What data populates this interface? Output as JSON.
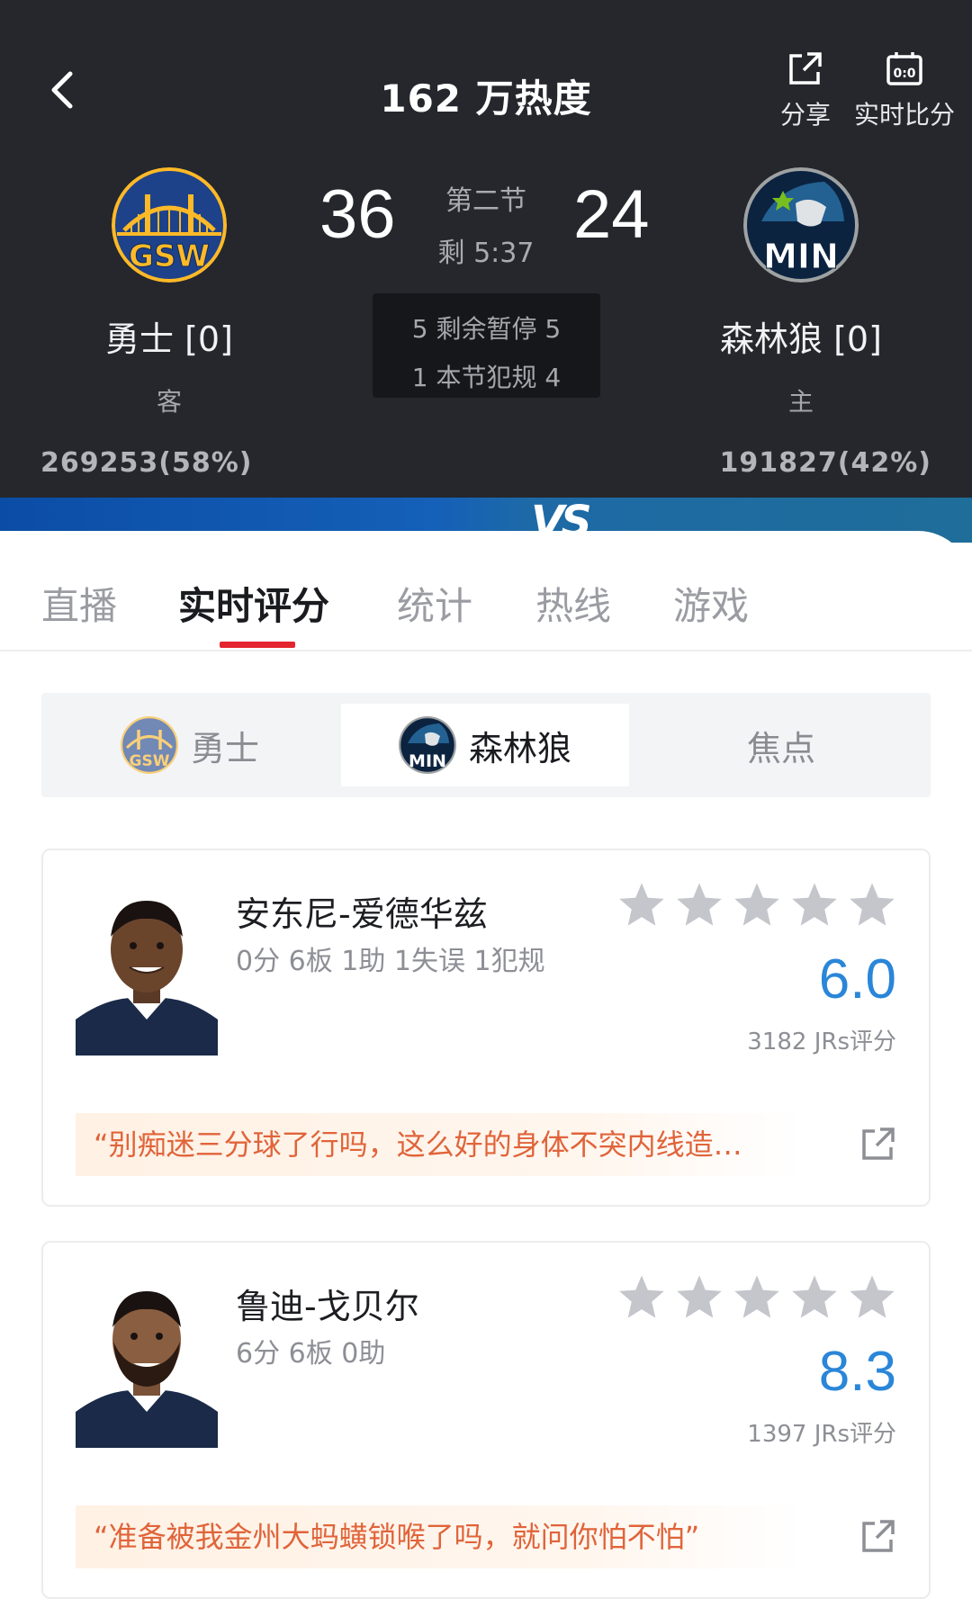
{
  "header": {
    "heat": "162 万热度",
    "share_label": "分享",
    "live_score_label": "实时比分",
    "away": {
      "name": "勇士 [0]",
      "side": "客",
      "abbr": "GSW",
      "score": "36",
      "votes": "269253(58%)",
      "color": "#1d428a",
      "accent": "#fdb927"
    },
    "home": {
      "name": "森林狼 [0]",
      "side": "主",
      "abbr": "MIN",
      "score": "24",
      "votes": "191827(42%)",
      "color": "#0c2340",
      "accent": "#78be20"
    },
    "period": "第二节",
    "clock": "剩 5:37",
    "timeouts": "5 剩余暂停 5",
    "fouls": "1 本节犯规 4",
    "vs": "VS"
  },
  "tabs": [
    {
      "label": "直播"
    },
    {
      "label": "实时评分"
    },
    {
      "label": "统计"
    },
    {
      "label": "热线"
    },
    {
      "label": "游戏"
    }
  ],
  "active_tab": "实时评分",
  "subtabs": [
    {
      "label": "勇士"
    },
    {
      "label": "森林狼"
    },
    {
      "label": "焦点"
    }
  ],
  "active_subtab": "森林狼",
  "players": [
    {
      "name": "安东尼-爱德华兹",
      "stats": "0分 6板 1助 1失误 1犯规",
      "rating": "6.0",
      "votes": "3182 JRs评分",
      "comment": "“别痴迷三分球了行吗，这么好的身体不突内线造…",
      "stars": 5
    },
    {
      "name": "鲁迪-戈贝尔",
      "stats": "6分 6板 0助",
      "rating": "8.3",
      "votes": "1397 JRs评分",
      "comment": "“准备被我金州大蚂蟥锁喉了吗，就问你怕不怕”",
      "stars": 5
    }
  ],
  "colors": {
    "accent_red": "#e4242e",
    "rating_blue": "#2a86d8",
    "comment_orange": "#e0643a",
    "header_bg": "#25272d"
  }
}
